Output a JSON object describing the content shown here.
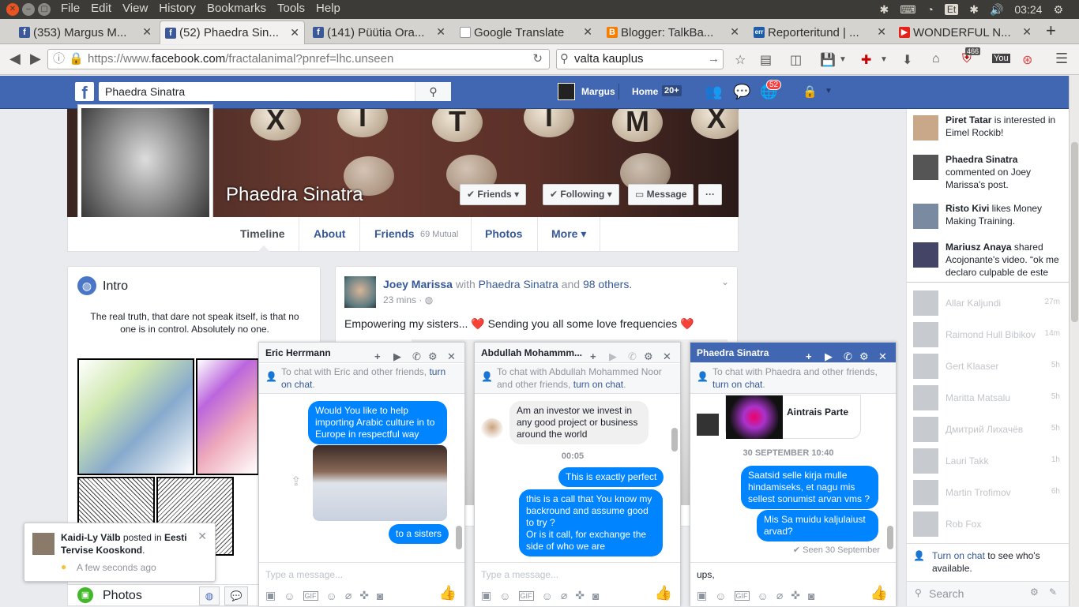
{
  "os": {
    "menus": [
      "File",
      "Edit",
      "View",
      "History",
      "Bookmarks",
      "Tools",
      "Help"
    ],
    "keyboard_layout": "Et",
    "time": "03:24"
  },
  "browser": {
    "tabs": [
      {
        "label": "(353) Margus M...",
        "icon": "facebook-icon",
        "active": false
      },
      {
        "label": "(52) Phaedra Sin...",
        "icon": "facebook-icon",
        "active": true
      },
      {
        "label": "(141) Püütia Ora...",
        "icon": "facebook-icon",
        "active": false
      },
      {
        "label": "Google Translate",
        "icon": "google-translate-icon",
        "active": false
      },
      {
        "label": "Blogger: TalkBa...",
        "icon": "blogger-icon",
        "active": false
      },
      {
        "label": "Reporteritund | ...",
        "icon": "err-icon",
        "active": false
      },
      {
        "label": "WONDERFUL N...",
        "icon": "youtube-icon",
        "active": false
      }
    ],
    "url_prefix": "https://www.",
    "url_domain": "facebook.com",
    "url_path": "/fractalanimal?pnref=lhc.unseen",
    "search_value": "valta kauplus",
    "badge_466": "466",
    "colors": {
      "fb_blue": "#4267b2",
      "messenger_blue": "#0084ff"
    }
  },
  "fb_header": {
    "search_value": "Phaedra Sinatra",
    "user_name": "Margus",
    "home_label": "Home",
    "home_badge": "20+",
    "notif_badge": "52"
  },
  "profile": {
    "name": "Phaedra Sinatra",
    "friends_btn": "Friends",
    "following_btn": "Following",
    "message_btn": "Message",
    "more_btn": "···",
    "nav": {
      "timeline": "Timeline",
      "about": "About",
      "friends": "Friends",
      "friends_mutual": "69 Mutual",
      "photos": "Photos",
      "more": "More"
    }
  },
  "intro": {
    "title": "Intro",
    "bio": "The real truth, that dare not speak itself, is that no one is in control. Absolutely no one."
  },
  "post": {
    "author": "Joey Marissa",
    "with_text": "with",
    "tagged": "Phaedra Sinatra",
    "and_text": "and",
    "others": "98 others.",
    "time": "23 mins",
    "body": "Empowering my sisters... ❤️ Sending you all some love frequencies ❤️"
  },
  "ticker": [
    {
      "name": "Piret Tatar",
      "text": " is interested in Eimel Rockib!"
    },
    {
      "name": "Phaedra Sinatra",
      "text": " commented on Joey Marissa's post."
    },
    {
      "name": "Risto Kivi",
      "text": " likes Money Making Training."
    },
    {
      "name": "Mariusz Anaya",
      "text": " shared Acojonante's video. “ok me declaro culpable de este"
    }
  ],
  "chat_friends": [
    {
      "name": "Allar Kaljundi",
      "time": "27m"
    },
    {
      "name": "Raimond Hull Bibikov",
      "time": "14m"
    },
    {
      "name": "Gert Klaaser",
      "time": "5h"
    },
    {
      "name": "Maritta Matsalu",
      "time": "5h"
    },
    {
      "name": "Дмитрий Лихачёв",
      "time": "5h"
    },
    {
      "name": "Lauri Takk",
      "time": "1h"
    },
    {
      "name": "Martin Trofimov",
      "time": "6h"
    },
    {
      "name": "Rob Fox",
      "time": ""
    }
  ],
  "turn_on_chat": {
    "link": "Turn on chat",
    "rest": " to see who's available."
  },
  "sidebar_search_placeholder": "Search",
  "chats": [
    {
      "title": "Eric Herrmann",
      "note_pre": "To chat with Eric and other friends, ",
      "note_link": "turn on chat",
      "messages": [
        {
          "from": "me",
          "text": "Would You like to help importing Arabic culture in to Europe in respectful way"
        },
        {
          "from": "me",
          "text": "to a sisters"
        }
      ],
      "placeholder": "Type a message..."
    },
    {
      "title": "Abdullah Mohammm...",
      "note_pre": "To chat with Abdullah Mohammed Noor and other friends, ",
      "note_link": "turn on chat",
      "messages": [
        {
          "from": "them",
          "text": "Am an investor we invest in any good project or business around the world"
        },
        {
          "from": "time",
          "text": "00:05"
        },
        {
          "from": "me",
          "text": "This is exactly perfect"
        },
        {
          "from": "me",
          "text": "this is a call that You know my backround and assume good to try ?\nOr is it call, for exchange the side of who we are"
        }
      ],
      "placeholder": "Type a message..."
    },
    {
      "title": "Phaedra Sinatra",
      "note_pre": "To chat with Phaedra and other friends, ",
      "note_link": "turn on chat",
      "shared_title": "Aintrais Parte",
      "date_sep": "30 SEPTEMBER 10:40",
      "messages": [
        {
          "from": "me",
          "text": "Saatsid selle kirja mulle hindamiseks, et nagu mis sellest sonumist arvan vms ?"
        },
        {
          "from": "me",
          "text": "Mis Sa muidu kaljulaiust arvad?"
        }
      ],
      "seen": "Seen 30 September",
      "input_value": "ups,"
    }
  ],
  "notification": {
    "name": "Kaidi-Ly Välb",
    "mid": " posted in ",
    "group": "Eesti Tervise Kooskond",
    "time": "A few seconds ago"
  },
  "photos_label": "Photos"
}
